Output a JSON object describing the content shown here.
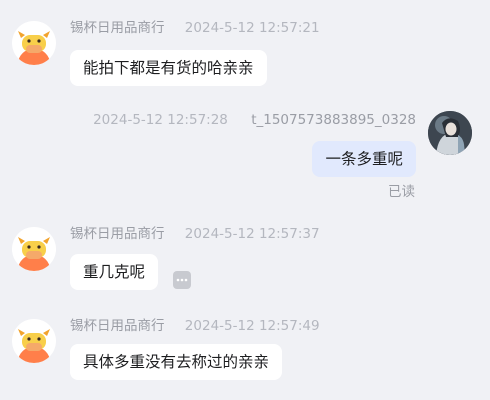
{
  "messages": [
    {
      "shop_name": "锡杯日用品商行",
      "time": "2024-5-12 12:57:21",
      "text": "能拍下都是有货的哈亲亲"
    },
    {
      "user_name": "t_1507573883895_0328",
      "time": "2024-5-12 12:57:28",
      "text": "一条多重呢",
      "status": "已读"
    },
    {
      "shop_name": "锡杯日用品商行",
      "time": "2024-5-12 12:57:37",
      "text": "重几克呢",
      "more_icon": "ellipsis-icon"
    },
    {
      "shop_name": "锡杯日用品商行",
      "time": "2024-5-12 12:57:49",
      "text": "具体多重没有去称过的亲亲"
    }
  ],
  "colors": {
    "background": "#f0f1f5",
    "incoming_bubble": "#ffffff",
    "outgoing_bubble": "#e1e9fd",
    "avatar_orange": "#ff7f4a"
  }
}
